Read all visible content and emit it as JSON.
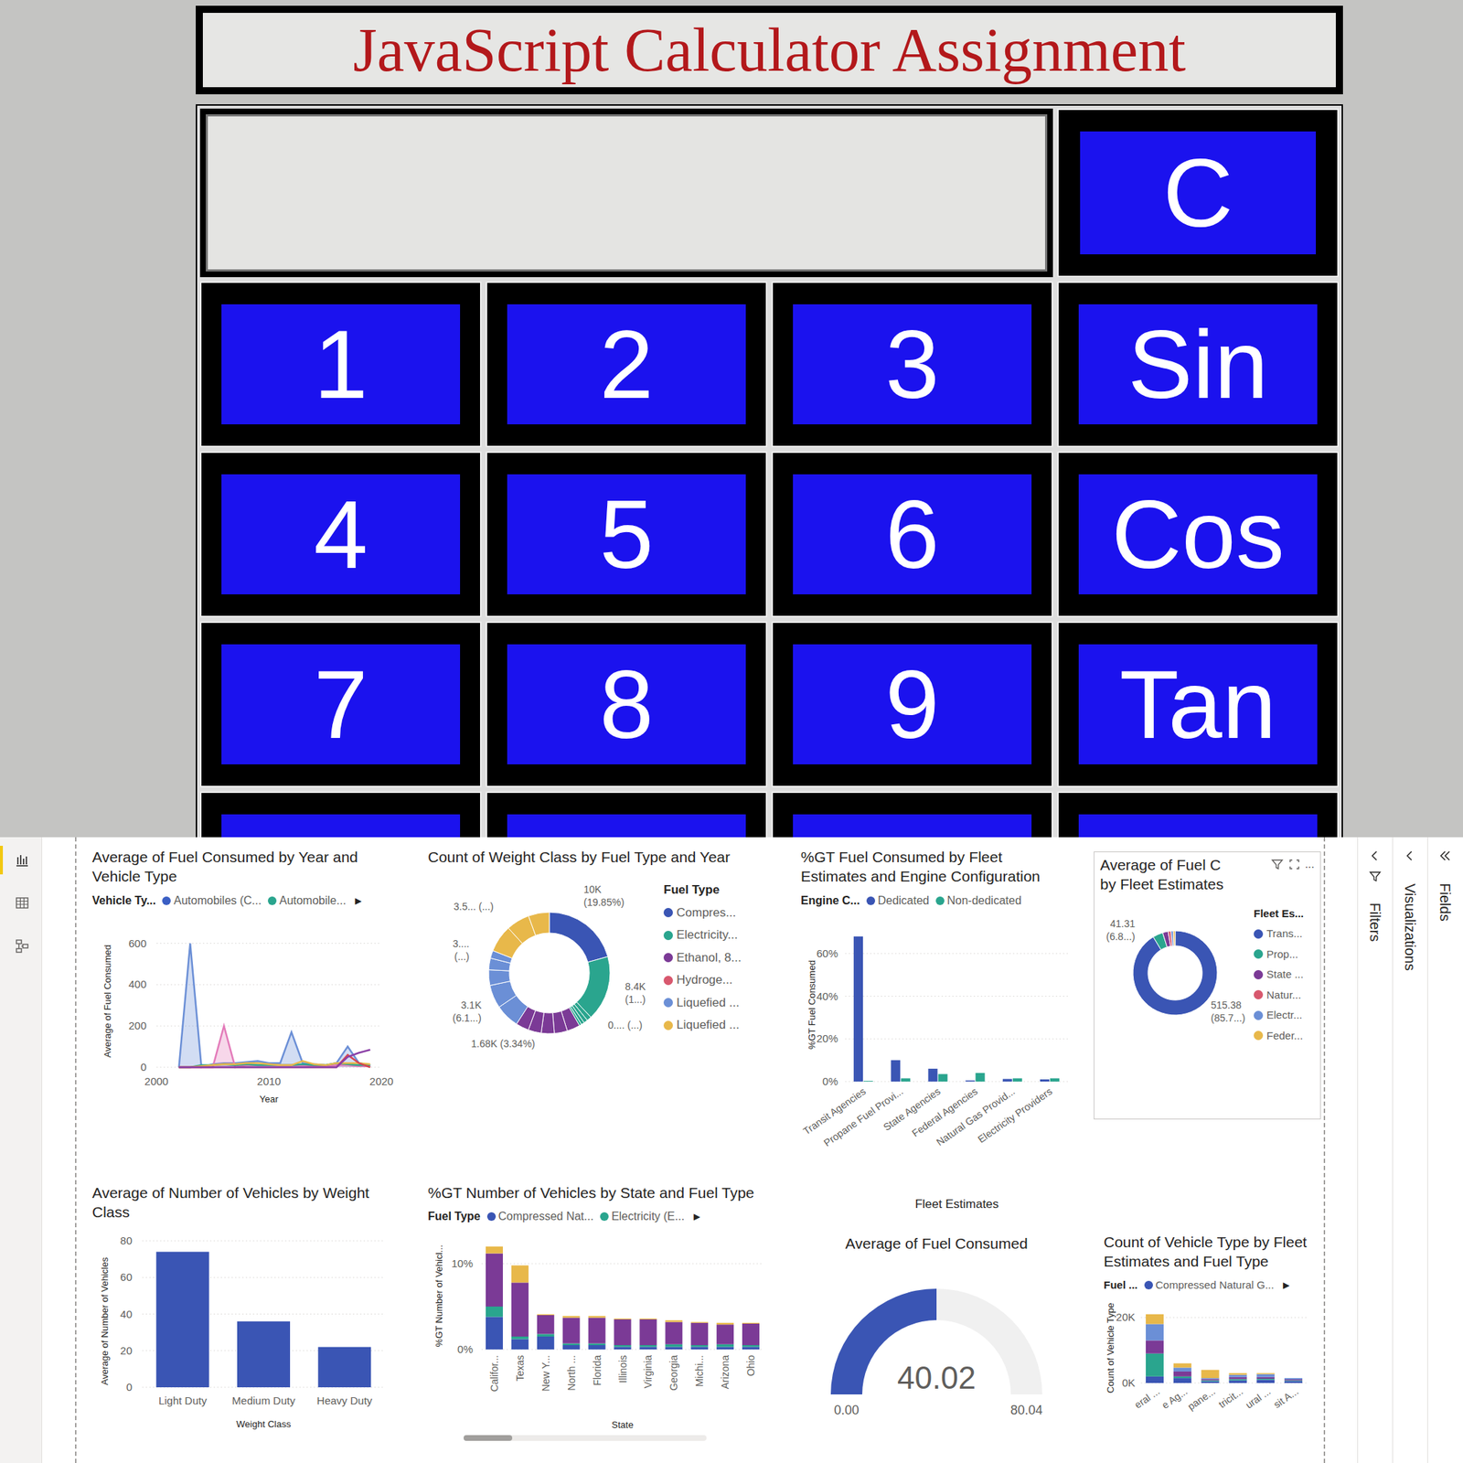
{
  "calculator": {
    "title": "JavaScript Calculator Assignment",
    "display": "",
    "clear_key": "C",
    "rows": [
      [
        "1",
        "2",
        "3",
        "Sin"
      ],
      [
        "4",
        "5",
        "6",
        "Cos"
      ],
      [
        "7",
        "8",
        "9",
        "Tan"
      ],
      [
        "",
        "",
        "",
        ""
      ]
    ]
  },
  "report": {
    "nav": [
      {
        "selected": true
      },
      {
        "selected": false
      },
      {
        "selected": false
      }
    ],
    "panes": [
      {
        "label": "Filters"
      },
      {
        "label": "Visualizations"
      },
      {
        "label": "Fields"
      }
    ],
    "fuel_by_year": {
      "title": "Average of Fuel Consumed by Year and Vehicle Type",
      "legend_title": "Vehicle Ty...",
      "legend": [
        {
          "label": "Automobiles (C...",
          "color": "#3b5fc4"
        },
        {
          "label": "Automobile...",
          "color": "#2aa58e"
        }
      ],
      "legend_more": "▶",
      "y_title": "Average of Fuel Consumed",
      "x_title": "Year",
      "y_ticks": [
        "600",
        "400",
        "200",
        "0"
      ],
      "x_ticks": [
        "2000",
        "2010",
        "2020"
      ],
      "x": [
        2002,
        2003,
        2004,
        2005,
        2006,
        2007,
        2008,
        2009,
        2010,
        2011,
        2012,
        2013,
        2014,
        2015,
        2016,
        2017,
        2018,
        2019
      ],
      "series": [
        {
          "color": "#6b8fd6",
          "area": true,
          "values": [
            0,
            600,
            0,
            15,
            20,
            20,
            25,
            30,
            20,
            20,
            170,
            20,
            15,
            10,
            20,
            100,
            20,
            10
          ]
        },
        {
          "color": "#e37ab9",
          "area": true,
          "values": [
            0,
            0,
            0,
            0,
            200,
            0,
            10,
            10,
            10,
            10,
            10,
            10,
            5,
            5,
            10,
            10,
            5,
            5
          ]
        },
        {
          "color": "#2aa58e",
          "area": false,
          "values": [
            0,
            0,
            10,
            10,
            15,
            10,
            15,
            10,
            10,
            10,
            10,
            15,
            10,
            10,
            20,
            15,
            10,
            10
          ]
        },
        {
          "color": "#e8b84a",
          "area": false,
          "values": [
            0,
            0,
            5,
            10,
            15,
            15,
            20,
            20,
            15,
            10,
            10,
            30,
            15,
            10,
            20,
            20,
            20,
            15
          ]
        },
        {
          "color": "#d64550",
          "area": false,
          "values": [
            0,
            0,
            0,
            0,
            0,
            0,
            0,
            0,
            0,
            0,
            0,
            0,
            0,
            0,
            0,
            60,
            20,
            0
          ]
        },
        {
          "color": "#8a3ea6",
          "area": false,
          "values": [
            0,
            0,
            0,
            0,
            0,
            0,
            0,
            0,
            0,
            0,
            0,
            0,
            0,
            0,
            0,
            50,
            70,
            85
          ]
        }
      ]
    },
    "weight_by_fuel": {
      "title": "Count of Weight Class by Fuel Type and Year",
      "legend_title": "Fuel Type",
      "legend": [
        {
          "label": "Compres...",
          "color": "#3a55b4"
        },
        {
          "label": "Electricity...",
          "color": "#2aa58e"
        },
        {
          "label": "Ethanol, 8...",
          "color": "#7b3a96"
        },
        {
          "label": "Hydroge...",
          "color": "#d8586e"
        },
        {
          "label": "Liquefied ...",
          "color": "#6b8fd6"
        },
        {
          "label": "Liquefied ...",
          "color": "#e8b84a"
        }
      ],
      "segments": [
        {
          "value": 10000,
          "color": "#3a55b4"
        },
        {
          "value": 8400,
          "color": "#2aa58e"
        },
        {
          "value": 600,
          "color": "#2aa58e"
        },
        {
          "value": 500,
          "color": "#2aa58e"
        },
        {
          "value": 400,
          "color": "#2aa58e"
        },
        {
          "value": 300,
          "color": "#2aa58e"
        },
        {
          "value": 1680,
          "color": "#7b3a96"
        },
        {
          "value": 1680,
          "color": "#7b3a96"
        },
        {
          "value": 1680,
          "color": "#7b3a96"
        },
        {
          "value": 1680,
          "color": "#7b3a96"
        },
        {
          "value": 1680,
          "color": "#7b3a96"
        },
        {
          "value": 3100,
          "color": "#6b8fd6"
        },
        {
          "value": 3000,
          "color": "#6b8fd6"
        },
        {
          "value": 2000,
          "color": "#6b8fd6"
        },
        {
          "value": 1500,
          "color": "#6b8fd6"
        },
        {
          "value": 1000,
          "color": "#6b8fd6"
        },
        {
          "value": 3500,
          "color": "#e8b84a"
        },
        {
          "value": 3000,
          "color": "#e8b84a"
        },
        {
          "value": 2700,
          "color": "#e8b84a"
        }
      ],
      "labels": [
        {
          "lines": [
            "10K",
            "(19.85%)"
          ]
        },
        {
          "lines": [
            "8.4K",
            "(1...)"
          ]
        },
        {
          "lines": [
            "0.... (...)"
          ]
        },
        {
          "lines": [
            "1.68K (3.34%)"
          ]
        },
        {
          "lines": [
            "3.1K",
            "(6.1...)"
          ]
        },
        {
          "lines": [
            "3....",
            "(...)"
          ]
        },
        {
          "lines": [
            "3.5... (...)"
          ]
        }
      ]
    },
    "fuel_by_fleet_engine": {
      "title": "%GT Fuel Consumed by Fleet Estimates and Engine Configuration",
      "legend_title": "Engine C...",
      "y_title": "%GT Fuel Consumed",
      "x_title": "Fleet Estimates",
      "y_ticks": [
        "60%",
        "40%",
        "20%",
        "0%"
      ],
      "categories": [
        "Transit Agencies",
        "Propane Fuel Provi...",
        "State Agencies",
        "Federal Agencies",
        "Natural Gas Provid...",
        "Electricity Providers"
      ],
      "series": [
        {
          "label": "Dedicated",
          "color": "#3a55b4",
          "values": [
            68,
            10,
            6,
            0.5,
            1.2,
            1
          ]
        },
        {
          "label": "Non-dedicated",
          "color": "#2aa58e",
          "values": [
            0.3,
            1.5,
            3.5,
            4,
            1.5,
            1.5
          ]
        }
      ]
    },
    "fuel_by_fleet": {
      "title": "Average of Fuel C",
      "title_line2": "by Fleet Estimates",
      "toolbar_more": "...",
      "legend_title": "Fleet Es...",
      "legend": [
        {
          "label": "Trans...",
          "color": "#3a55b4"
        },
        {
          "label": "Prop...",
          "color": "#2aa58e"
        },
        {
          "label": "State ...",
          "color": "#7b3a96"
        },
        {
          "label": "Natur...",
          "color": "#d8586e"
        },
        {
          "label": "Electr...",
          "color": "#6b8fd6"
        },
        {
          "label": "Feder...",
          "color": "#e8b84a"
        }
      ],
      "values": [
        515.38,
        22,
        12,
        6,
        5,
        4
      ],
      "labels": [
        {
          "lines": [
            "41.31",
            "(6.8...)"
          ]
        },
        {
          "lines": [
            "515.38",
            "(85.7...)"
          ]
        }
      ]
    },
    "vehicles_by_weight": {
      "title": "Average of Number of Vehicles by Weight Class",
      "y_title": "Average of Number of Vehicles",
      "x_title": "Weight Class",
      "y_ticks": [
        "80",
        "60",
        "40",
        "20",
        "0"
      ],
      "categories": [
        "Light Duty",
        "Medium Duty",
        "Heavy Duty"
      ],
      "color": "#3a55b4",
      "values": [
        74,
        36,
        22
      ]
    },
    "vehicles_by_state": {
      "title": "%GT Number of Vehicles by State and Fuel Type",
      "legend_title": "Fuel Type",
      "legend": [
        {
          "label": "Compressed Nat...",
          "color": "#3a55b4"
        },
        {
          "label": "Electricity (E...",
          "color": "#2aa58e"
        }
      ],
      "legend_more": "▶",
      "y_title": "%GT Number of Vehicl...",
      "x_title": "State",
      "y_ticks": [
        "10%",
        "0%"
      ],
      "categories": [
        "Califor...",
        "Texas",
        "New Y...",
        "North ...",
        "Florida",
        "Illinois",
        "Virginia",
        "Georgia",
        "Michi...",
        "Arizona",
        "Ohio"
      ],
      "series": [
        {
          "color": "#3a55b4",
          "values": [
            3.8,
            1.2,
            1.5,
            0.5,
            0.5,
            0.3,
            0.3,
            0.3,
            0.3,
            0.3,
            0.3
          ]
        },
        {
          "color": "#2aa58e",
          "values": [
            1.2,
            0.3,
            0.3,
            0.2,
            0.2,
            0.2,
            0.2,
            0.3,
            0.2,
            0.3,
            0.2
          ]
        },
        {
          "color": "#7b3a96",
          "values": [
            6.2,
            6.3,
            2.2,
            3.0,
            3.0,
            3.0,
            3.0,
            2.6,
            2.6,
            2.3,
            2.5
          ]
        },
        {
          "color": "#e8b84a",
          "values": [
            0.8,
            2.0,
            0.1,
            0.2,
            0.2,
            0.1,
            0.1,
            0.2,
            0.1,
            0.2,
            0.1
          ]
        }
      ]
    },
    "gauge": {
      "title": "Average of Fuel Consumed",
      "value": "40.02",
      "min": "0.00",
      "max": "80.04",
      "level": 0.5
    },
    "vehicle_type_by_fleet": {
      "title": "Count of Vehicle Type by Fleet Estimates and Fuel Type",
      "legend_title": "Fuel ...",
      "legend": [
        {
          "label": "Compressed Natural G...",
          "color": "#3a55b4"
        }
      ],
      "legend_more": "▶",
      "y_title": "Count of Vehicle Type",
      "y_ticks": [
        "20K",
        "0K"
      ],
      "categories": [
        "eral ...",
        "e Ag...",
        "pane...",
        "tricit...",
        "ural ...",
        "sit A..."
      ],
      "series": [
        {
          "color": "#3a55b4",
          "values": [
            2000,
            1500,
            500,
            800,
            1000,
            600
          ]
        },
        {
          "color": "#2aa58e",
          "values": [
            7000,
            500,
            300,
            400,
            300,
            200
          ]
        },
        {
          "color": "#7b3a96",
          "values": [
            4000,
            1500,
            400,
            600,
            500,
            300
          ]
        },
        {
          "color": "#6b8fd6",
          "values": [
            5000,
            1200,
            300,
            700,
            900,
            400
          ]
        },
        {
          "color": "#e8b84a",
          "values": [
            3000,
            1300,
            2500,
            500,
            300,
            0
          ]
        }
      ]
    }
  }
}
